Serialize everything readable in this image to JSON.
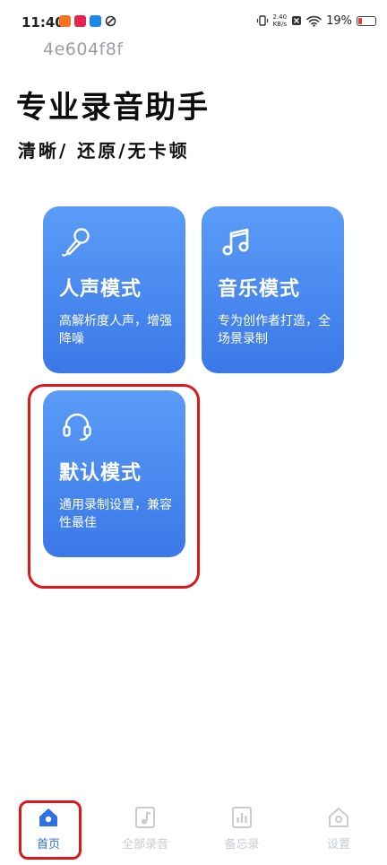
{
  "status_bar": {
    "time": "11:40",
    "net_speed_value": "2.40",
    "net_speed_unit": "KB/s",
    "battery": "19%",
    "battery_level": 0.19
  },
  "device_id": "4e604f8f",
  "header": {
    "title": "专业录音助手",
    "subtitle": "清晰/ 还原/无卡顿"
  },
  "modes": [
    {
      "title": "人声模式",
      "desc": "高解析度人声，增强降噪",
      "icon": "microphone-icon"
    },
    {
      "title": "音乐模式",
      "desc": "专为创作者打造，全场景录制",
      "icon": "music-note-icon"
    },
    {
      "title": "默认模式",
      "desc": "通用录制设置，兼容性最佳",
      "icon": "headphones-icon"
    }
  ],
  "tabs": [
    {
      "label": "首页",
      "icon": "home-icon",
      "active": true
    },
    {
      "label": "全部录音",
      "icon": "music-file-icon",
      "active": false
    },
    {
      "label": "备忘录",
      "icon": "chart-icon",
      "active": false
    },
    {
      "label": "设置",
      "icon": "settings-house-icon",
      "active": false
    }
  ],
  "colors": {
    "accent": "#2e72e6",
    "card_top": "#5a9cf7",
    "card_bottom": "#3b78e8",
    "highlight": "#e0161b",
    "inactive": "#c7ccd3"
  }
}
